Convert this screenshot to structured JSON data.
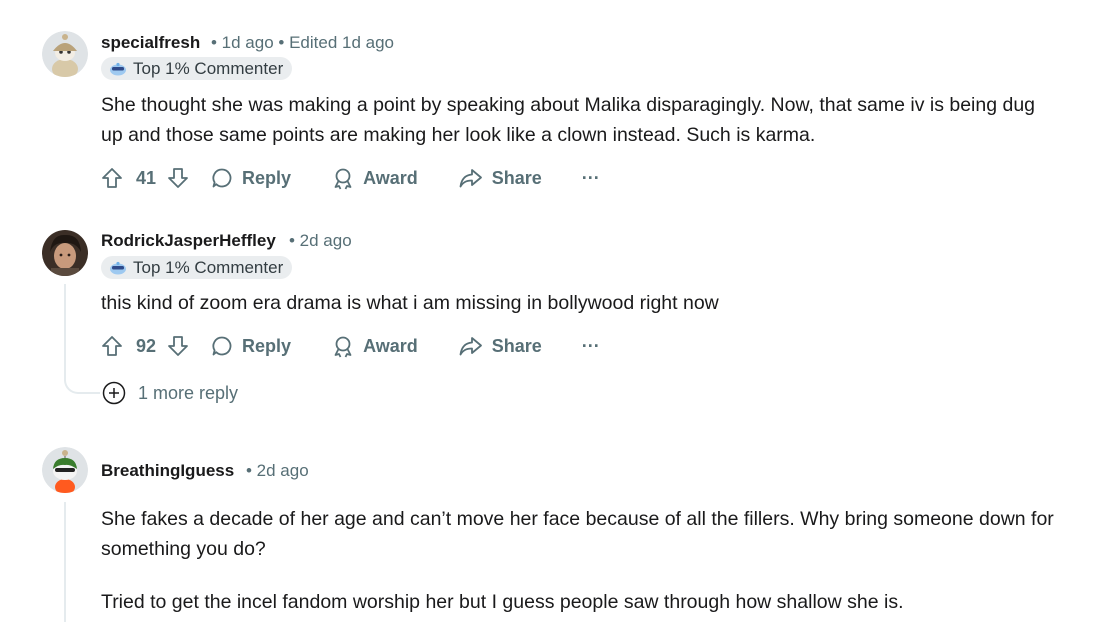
{
  "comments": [
    {
      "username": "specialfresh",
      "meta": "• 1d ago • Edited 1d ago",
      "badge": "Top 1% Commenter",
      "body": [
        "She thought she was making a point by speaking about Malika disparagingly. Now, that same iv is being dug",
        "up and those same points are making her look like a clown instead. Such is karma."
      ],
      "votes": "41",
      "reply": "Reply",
      "award": "Award",
      "share": "Share",
      "more": "···"
    },
    {
      "username": "RodrickJasperHeffley",
      "meta": "• 2d ago",
      "badge": "Top 1% Commenter",
      "body": [
        "this kind of zoom era drama is what i am missing in bollywood right now"
      ],
      "votes": "92",
      "reply": "Reply",
      "award": "Award",
      "share": "Share",
      "more": "···",
      "more_replies": "1 more reply"
    },
    {
      "username": "BreathingIguess",
      "meta": "• 2d ago",
      "body": [
        "She fakes a decade of her age and can’t move her face because of all the fillers. Why bring someone down for",
        "something you do?",
        "Tried to get the incel fandom worship her but I guess people saw through how shallow she is."
      ]
    }
  ],
  "colors": {
    "meta_gray": "#576f76",
    "badge_bg": "#eaedef",
    "thread_line": "#e5ebee"
  },
  "icons": [
    "upvote-icon",
    "downvote-icon",
    "comment-icon",
    "award-icon",
    "share-icon",
    "overflow-icon",
    "expand-plus-icon",
    "commenter-badge-icon"
  ]
}
